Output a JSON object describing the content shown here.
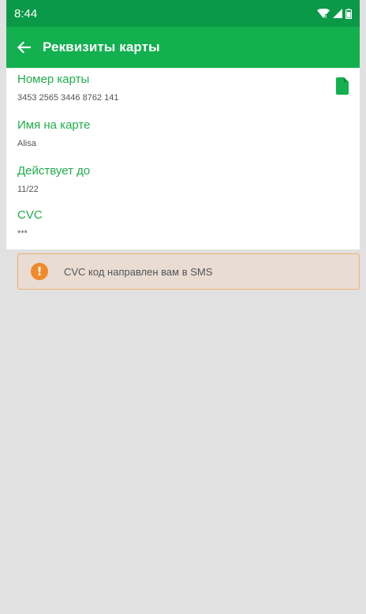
{
  "status_bar": {
    "time": "8:44"
  },
  "app_bar": {
    "title": "Реквизиты карты"
  },
  "fields": [
    {
      "label": "Номер карты",
      "value": "3453 2565 3446 8762 141"
    },
    {
      "label": "Имя на карте",
      "value": "Alisa"
    },
    {
      "label": "Действует до",
      "value": "11/22"
    },
    {
      "label": "CVC",
      "value": "***"
    }
  ],
  "banner": {
    "icon": "!",
    "text": "CVC код направлен вам в SMS"
  },
  "colors": {
    "status_bar": "#0a9a47",
    "app_bar": "#12b04e",
    "label": "#1fae4c",
    "warning": "#f08a2a",
    "banner_bg": "#e8dcd3",
    "background": "#e1e1e1"
  },
  "icons": {
    "back": "arrow-left-icon",
    "copy": "copy-document-icon",
    "warning": "exclamation-circle-icon",
    "wifi": "wifi-icon",
    "signal": "signal-icon",
    "battery": "battery-icon"
  }
}
